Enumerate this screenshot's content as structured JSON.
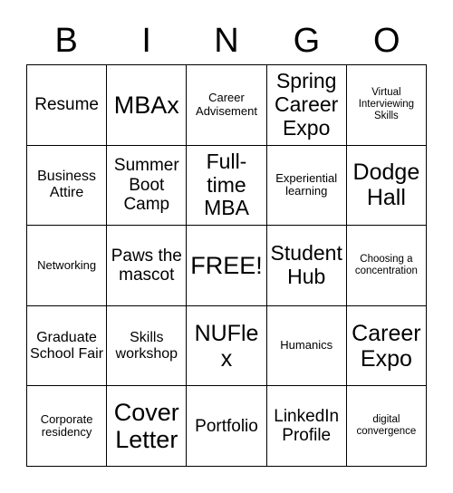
{
  "card": {
    "header_letters": [
      "B",
      "I",
      "N",
      "G",
      "O"
    ],
    "rows": [
      [
        {
          "label": "Resume",
          "size": "md"
        },
        {
          "label": "MBAx",
          "size": "xxl"
        },
        {
          "label": "Career Advisement",
          "size": "xs"
        },
        {
          "label": "Spring Career Expo",
          "size": "lg"
        },
        {
          "label": "Virtual Interviewing Skills",
          "size": "xxs"
        }
      ],
      [
        {
          "label": "Business Attire",
          "size": "sm"
        },
        {
          "label": "Summer Boot Camp",
          "size": "md"
        },
        {
          "label": "Full-time MBA",
          "size": "lg"
        },
        {
          "label": "Experiential learning",
          "size": "xs"
        },
        {
          "label": "Dodge Hall",
          "size": "xl"
        }
      ],
      [
        {
          "label": "Networking",
          "size": "xs"
        },
        {
          "label": "Paws the mascot",
          "size": "md"
        },
        {
          "label": "FREE!",
          "size": "xxl"
        },
        {
          "label": "Student Hub",
          "size": "lg"
        },
        {
          "label": "Choosing a concentration",
          "size": "xxs"
        }
      ],
      [
        {
          "label": "Graduate School Fair",
          "size": "sm"
        },
        {
          "label": "Skills workshop",
          "size": "sm"
        },
        {
          "label": "NUFlex",
          "size": "xl"
        },
        {
          "label": "Humanics",
          "size": "xs"
        },
        {
          "label": "Career Expo",
          "size": "xl"
        }
      ],
      [
        {
          "label": "Corporate residency",
          "size": "xs"
        },
        {
          "label": "Cover Letter",
          "size": "xxl"
        },
        {
          "label": "Portfolio",
          "size": "md"
        },
        {
          "label": "LinkedIn Profile",
          "size": "md"
        },
        {
          "label": "digital convergence",
          "size": "xxs"
        }
      ]
    ]
  },
  "style": {
    "background_color": "#ffffff",
    "text_color": "#000000",
    "border_color": "#000000"
  }
}
